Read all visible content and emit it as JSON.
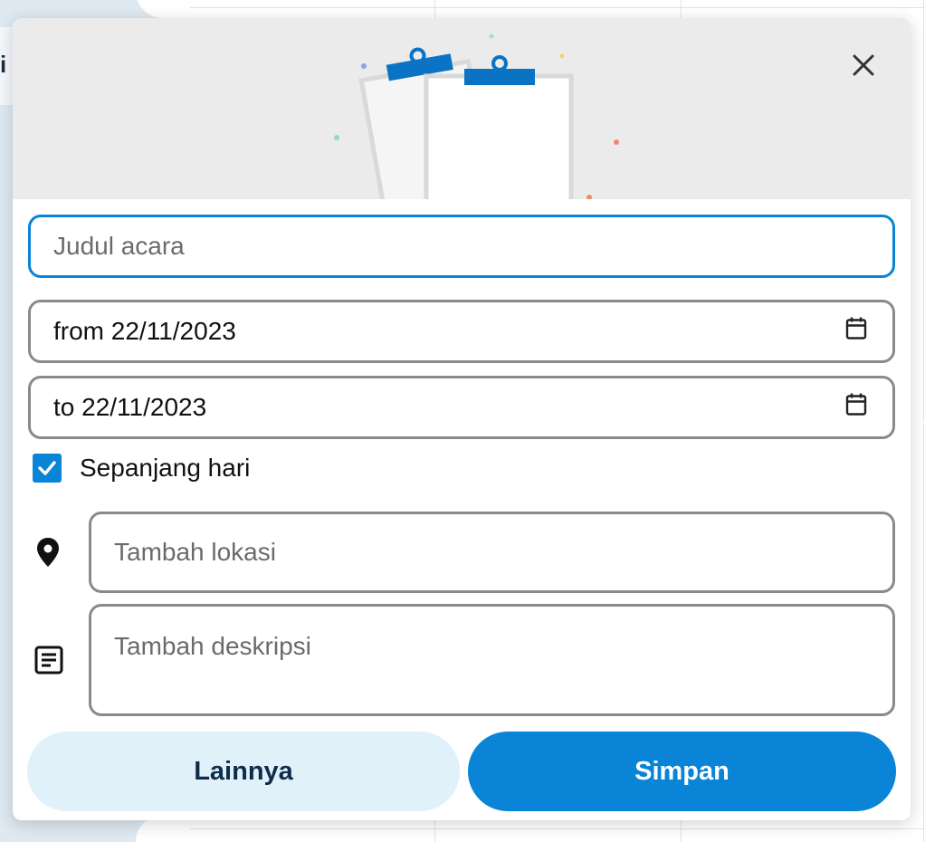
{
  "background": {
    "side_letter": "i"
  },
  "form": {
    "title_placeholder": "Judul acara",
    "from_value": "from 22/11/2023",
    "to_value": "to 22/11/2023",
    "all_day_label": "Sepanjang hari",
    "all_day_checked": true,
    "location_placeholder": "Tambah lokasi",
    "description_placeholder": "Tambah deskripsi"
  },
  "buttons": {
    "more_label": "Lainnya",
    "save_label": "Simpan"
  },
  "icons": {
    "close": "close-icon",
    "calendar": "calendar-icon",
    "checkbox": "check-icon",
    "location": "location-pin-icon",
    "description": "notes-icon"
  },
  "colors": {
    "accent": "#0a84d6",
    "secondary_button": "#e0f1fa",
    "secondary_text": "#0f2d4a",
    "header_bg": "#ebebeb",
    "field_border": "#8a8a8a"
  }
}
